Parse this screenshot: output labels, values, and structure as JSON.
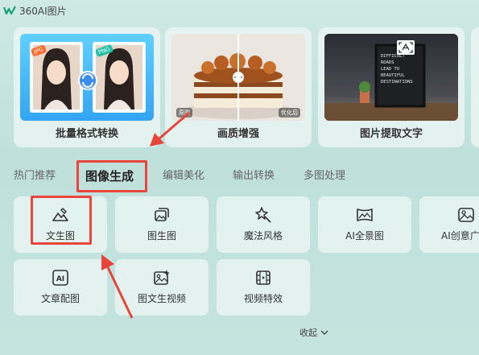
{
  "app": {
    "title": "360AI图片"
  },
  "features": [
    {
      "label": "批量格式转换",
      "badges": [
        "JPG",
        "PNG"
      ]
    },
    {
      "label": "画质增强",
      "badges": [
        "原图",
        "优化后"
      ]
    },
    {
      "label": "图片提取文字",
      "board_text": [
        "DIFFICULT",
        "ROADS",
        "LEAD TO",
        "BEAUTIFUL",
        "DESTINATIONS"
      ]
    }
  ],
  "tabs": [
    "热门推荐",
    "图像生成",
    "编辑美化",
    "输出转换",
    "多图处理"
  ],
  "active_tab": "图像生成",
  "tools": [
    {
      "label": "文生图",
      "icon": "mountain-pen-icon"
    },
    {
      "label": "图生图",
      "icon": "image-stack-icon"
    },
    {
      "label": "魔法风格",
      "icon": "magic-star-icon"
    },
    {
      "label": "AI全景图",
      "icon": "panorama-icon"
    },
    {
      "label": "AI创意广",
      "icon": "image-icon"
    },
    {
      "label": "文章配图",
      "icon": "ai-badge-icon",
      "icon_text": "AI"
    },
    {
      "label": "图文生视频",
      "icon": "image-sparkle-icon"
    },
    {
      "label": "视频特效",
      "icon": "film-icon"
    }
  ],
  "collapse_label": "收起",
  "colors": {
    "annotation": "#e8453c",
    "accent": "#34a5f3",
    "background": "#c6e4df"
  }
}
